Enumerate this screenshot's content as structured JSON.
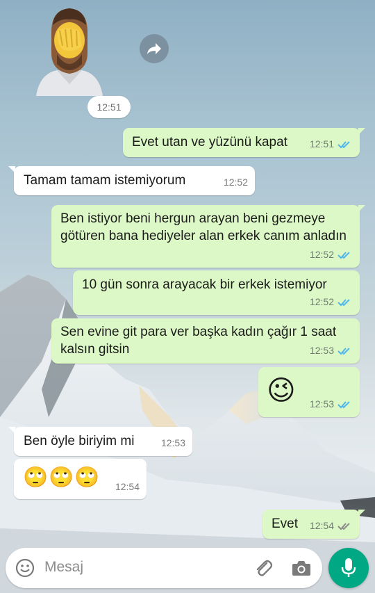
{
  "sticker": {
    "time": "12:51"
  },
  "messages": [
    {
      "dir": "out",
      "text": "Evet utan ve yüzünü kapat",
      "time": "12:51",
      "status": "read"
    },
    {
      "dir": "in",
      "text": "Tamam tamam istemiyorum",
      "time": "12:52"
    },
    {
      "dir": "out",
      "text": "Ben istiyor beni hergun arayan beni gezmeye götüren bana hediyeler alan erkek canım anladın",
      "time": "12:52",
      "status": "read"
    },
    {
      "dir": "out",
      "text": "10 gün sonra arayacak bir erkek istemiyor",
      "time": "12:52",
      "status": "read"
    },
    {
      "dir": "out",
      "text": "Sen evine git para ver başka kadın çağır 1 saat kalsın gitsin",
      "time": "12:53",
      "status": "read"
    },
    {
      "dir": "out",
      "text": "😉",
      "time": "12:53",
      "status": "read"
    },
    {
      "dir": "in",
      "text": "Ben öyle biriyim mi",
      "time": "12:53"
    },
    {
      "dir": "in",
      "text": "🙄🙄🙄",
      "time": "12:54"
    },
    {
      "dir": "out",
      "text": "Evet",
      "time": "12:54",
      "status": "delivered"
    }
  ],
  "input": {
    "placeholder": "Mesaj"
  },
  "colors": {
    "outgoing": "#dcf8c6",
    "incoming": "#ffffff",
    "read_ticks": "#4fb6ec",
    "delivered_ticks": "#8a8a8a",
    "mic": "#00a884"
  },
  "icons": [
    "forward-icon",
    "emoji-icon",
    "attach-icon",
    "camera-icon",
    "mic-icon"
  ]
}
